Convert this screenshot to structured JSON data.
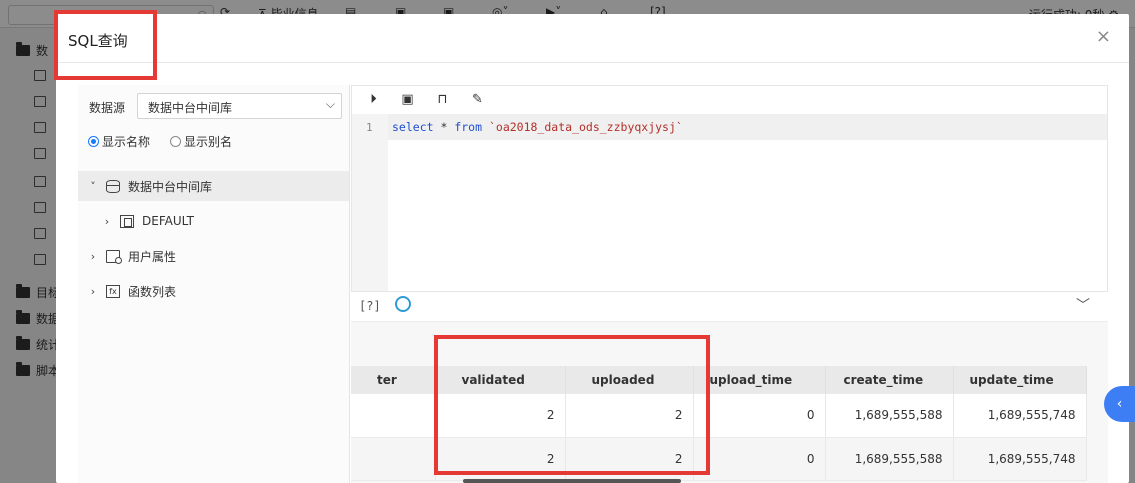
{
  "background": {
    "tools": [
      "毕业信息"
    ],
    "status": "运行成功: 0秒",
    "tree_labels": [
      "数",
      "目标",
      "数据",
      "统计",
      "脚本"
    ]
  },
  "modal": {
    "title": "SQL查询",
    "close_glyph": "×"
  },
  "datasource": {
    "label": "数据源",
    "selected": "数据中台中间库"
  },
  "radios": [
    {
      "label": "显示名称",
      "checked": true
    },
    {
      "label": "显示别名",
      "checked": false
    }
  ],
  "tree": [
    {
      "label": "数据中台中间库",
      "icon": "database-icon",
      "expanded": true
    },
    {
      "label": "DEFAULT",
      "icon": "table-icon",
      "expanded": false
    },
    {
      "label": "用户属性",
      "icon": "property-icon",
      "expanded": false
    },
    {
      "label": "函数列表",
      "icon": "function-icon",
      "expanded": false
    }
  ],
  "editor": {
    "line_number": "1",
    "code_keyword1": "select",
    "code_star": " * ",
    "code_keyword2": "from",
    "code_table": "`oa2018_data_ods_zzbyqxjysj`"
  },
  "result_toolbar": {
    "help": "[?]"
  },
  "table": {
    "columns": [
      "ter",
      "validated",
      "uploaded",
      "upload_time",
      "create_time",
      "update_time"
    ],
    "rows": [
      [
        "",
        "2",
        "2",
        "0",
        "1,689,555,588",
        "1,689,555,748"
      ],
      [
        "",
        "2",
        "2",
        "0",
        "1,689,555,588",
        "1,689,555,748"
      ]
    ]
  },
  "colors": {
    "highlight_box": "#e53935",
    "accent": "#3d7ef5",
    "keyword": "#1f4fd1",
    "string": "#b3302b"
  }
}
